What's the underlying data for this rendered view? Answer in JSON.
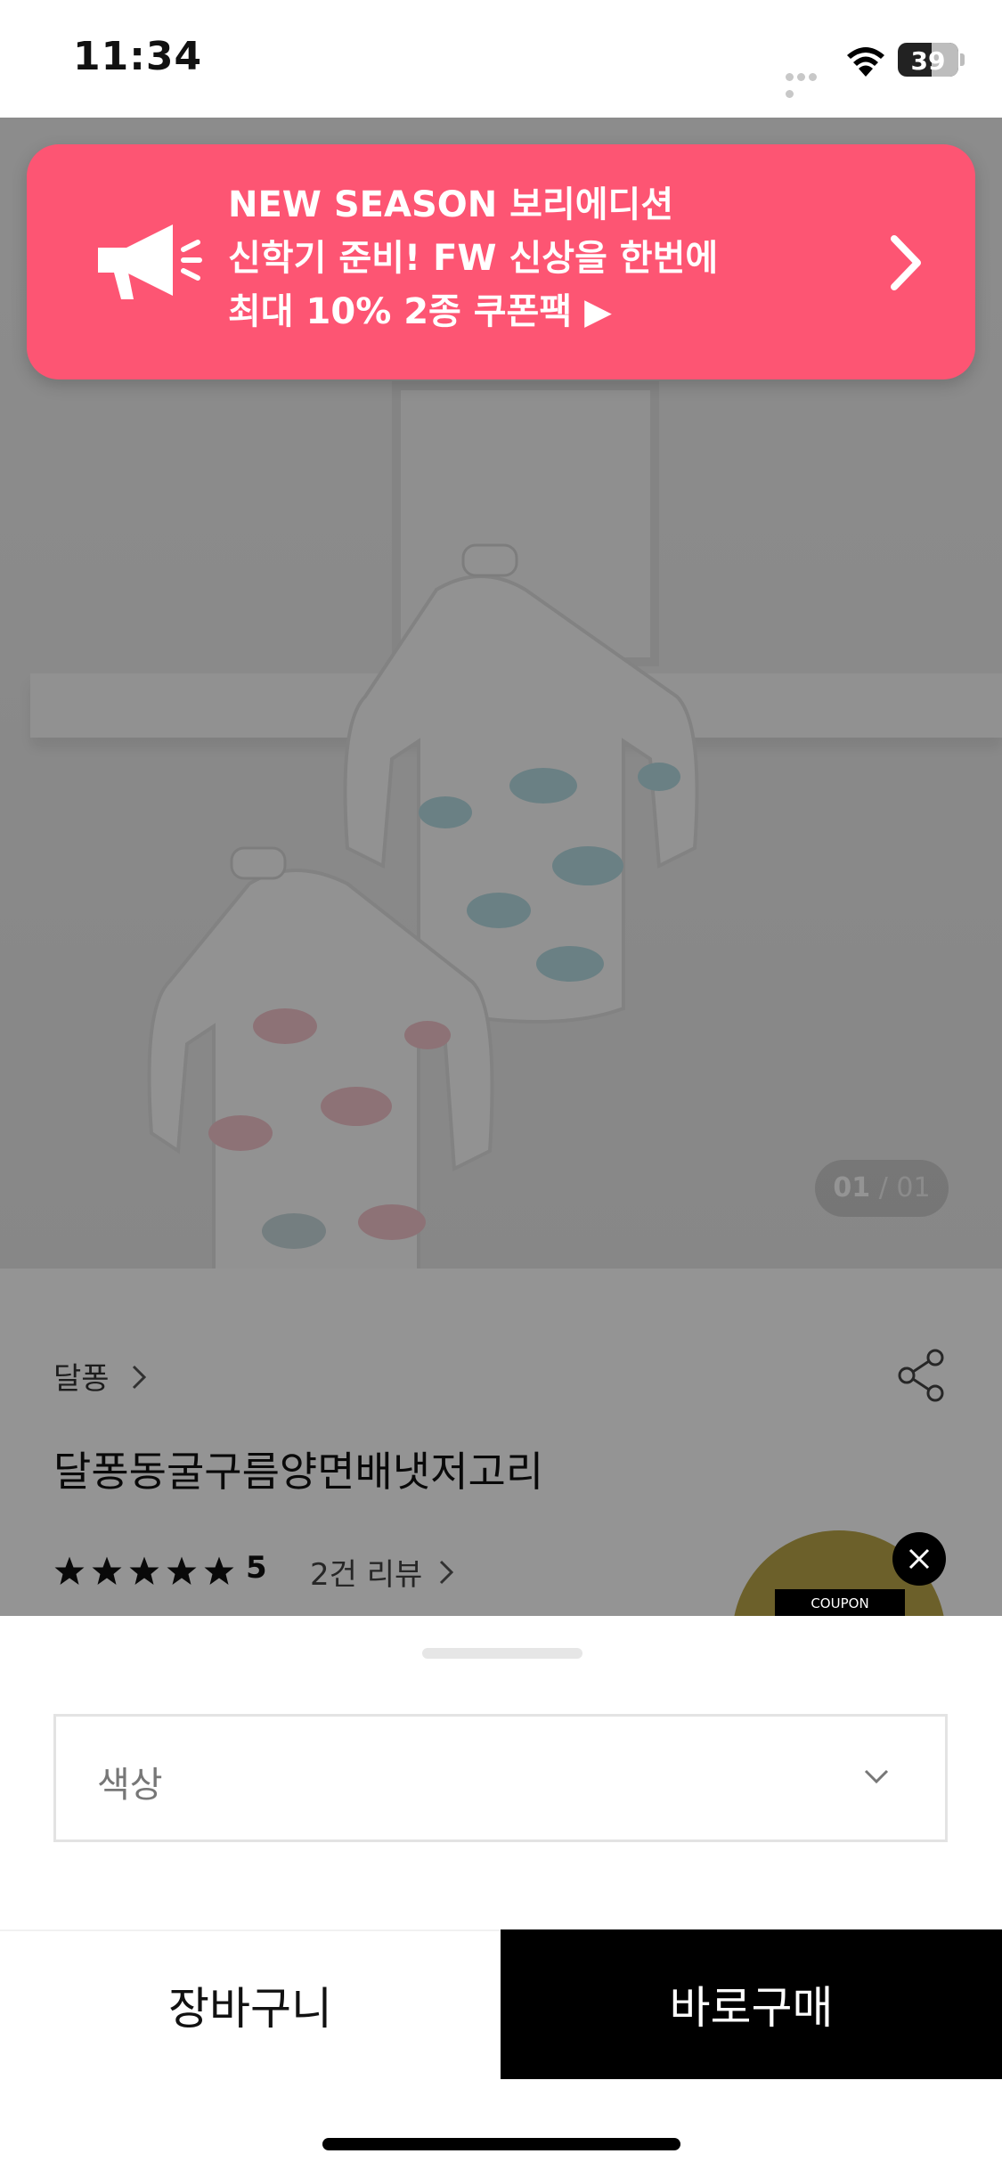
{
  "status_bar": {
    "time": "11:34",
    "battery": "39"
  },
  "promo_banner": {
    "line1": "NEW SEASON 보리에디션",
    "line2": "신학기 준비! FW 신상을 한번에",
    "line3": "최대 10% 2종 쿠폰팩 ▶",
    "icon": "megaphone-icon",
    "color": "#fd5573"
  },
  "product_image": {
    "current": "01",
    "separator": "/",
    "total": "01"
  },
  "product": {
    "brand": "달퐁",
    "title": "달퐁동굴구름양면배냇저고리",
    "rating": "5",
    "reviews": "2건 리뷰"
  },
  "coupon_float": {
    "label": "COUPON"
  },
  "sheet": {
    "color_select_placeholder": "색상"
  },
  "actions": {
    "cart": "장바구니",
    "buy": "바로구매"
  }
}
